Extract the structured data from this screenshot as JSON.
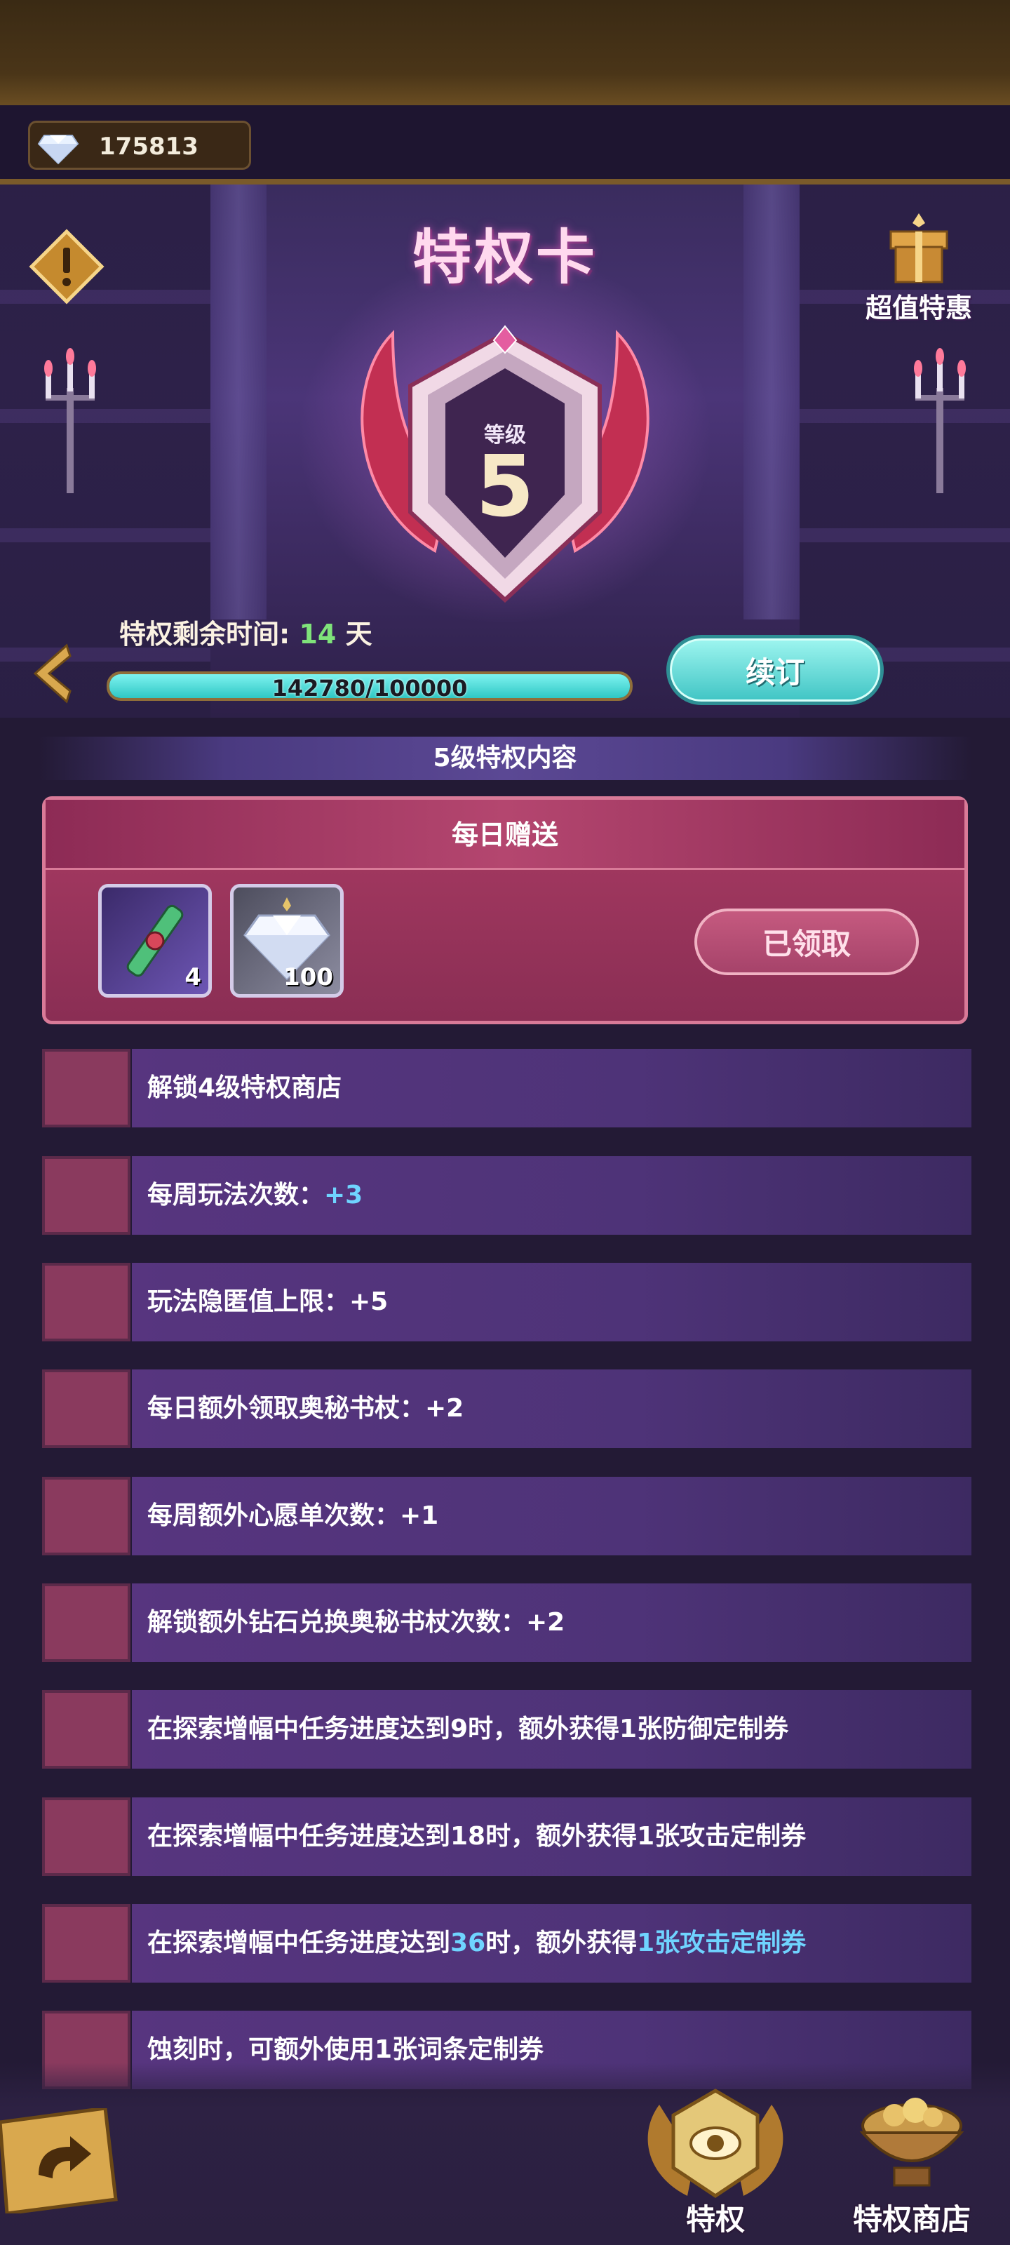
{
  "currency": {
    "icon": "diamond-icon",
    "amount": "175813"
  },
  "header": {
    "title": "特权卡",
    "deal_label": "超值特惠"
  },
  "badge": {
    "level_label": "等级",
    "level": "5"
  },
  "remaining": {
    "label": "特权剩余时间:",
    "days": "14",
    "unit": "天"
  },
  "progress": {
    "text": "142780/100000",
    "fill_fraction": 1.0
  },
  "renew_label": "续订",
  "section_title": "5级特权内容",
  "daily": {
    "title": "每日赠送",
    "items": [
      {
        "icon": "scepter-icon",
        "count": "4"
      },
      {
        "icon": "diamond-icon",
        "count": "100"
      }
    ],
    "claimed_label": "已领取"
  },
  "perks": [
    {
      "text": "解锁4级特权商店",
      "highlight": ""
    },
    {
      "text": "每周玩法次数：",
      "highlight": "+3"
    },
    {
      "text": "玩法隐匿值上限：+5",
      "highlight": ""
    },
    {
      "text": "每日额外领取奥秘书杖：+2",
      "highlight": ""
    },
    {
      "text": "每周额外心愿单次数：+1",
      "highlight": ""
    },
    {
      "text": "解锁额外钻石兑换奥秘书杖次数：+2",
      "highlight": ""
    },
    {
      "text": "在探索增幅中任务进度达到9时，额外获得1张防御定制券",
      "highlight": ""
    },
    {
      "text": "在探索增幅中任务进度达到18时，额外获得1张攻击定制券",
      "highlight": ""
    },
    {
      "text_a": "在探索增幅中任务进度达到",
      "hl_a": "36",
      "text_b": "时，额外获得",
      "hl_b": "1张攻击定制券"
    },
    {
      "text": "蚀刻时，可额外使用1张词条定制券",
      "highlight": ""
    }
  ],
  "nav": {
    "privilege_label": "特权",
    "shop_label": "特权商店"
  },
  "colors": {
    "accent_teal": "#3fc4c4",
    "highlight_blue": "#6fd4ff",
    "days_green": "#7fe37a",
    "daily_pink": "#a93b63"
  }
}
